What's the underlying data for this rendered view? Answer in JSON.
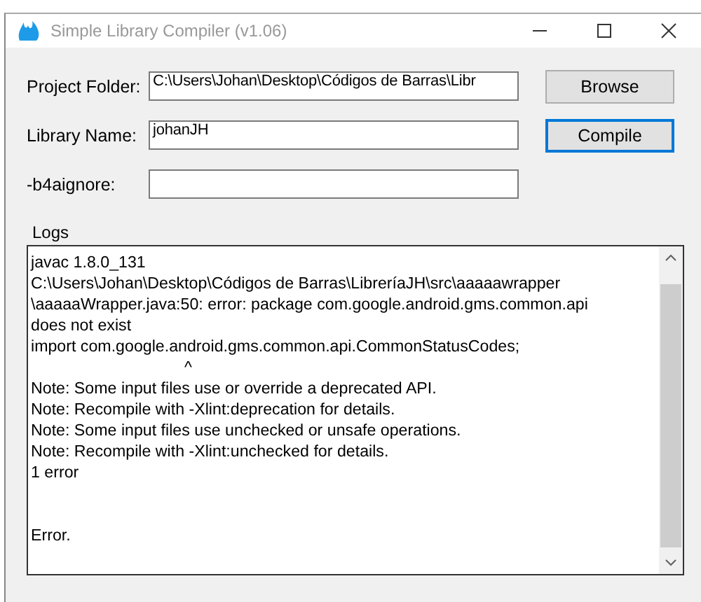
{
  "window": {
    "title": "Simple Library Compiler (v1.06)"
  },
  "fields": [
    {
      "label": "Project Folder:",
      "value": "C:\\Users\\Johan\\Desktop\\Códigos de Barras\\Libr"
    },
    {
      "label": "Library Name:",
      "value": "johanJH"
    },
    {
      "label": "-b4aignore:"
    }
  ],
  "buttons": [
    {
      "label": "Browse",
      "focused": false
    },
    {
      "label": "Compile",
      "focused": true
    }
  ],
  "logs": {
    "label": "Logs",
    "text": "javac 1.8.0_131\nC:\\Users\\Johan\\Desktop\\Códigos de Barras\\LibreríaJH\\src\\aaaaawrapper\n\\aaaaaWrapper.java:50: error: package com.google.android.gms.common.api\ndoes not exist\nimport com.google.android.gms.common.api.CommonStatusCodes;\n                                  ^\nNote: Some input files use or override a deprecated API.\nNote: Recompile with -Xlint:deprecation for details.\nNote: Some input files use unchecked or unsafe operations.\nNote: Recompile with -Xlint:unchecked for details.\n1 error\n\n\nError."
  }
}
